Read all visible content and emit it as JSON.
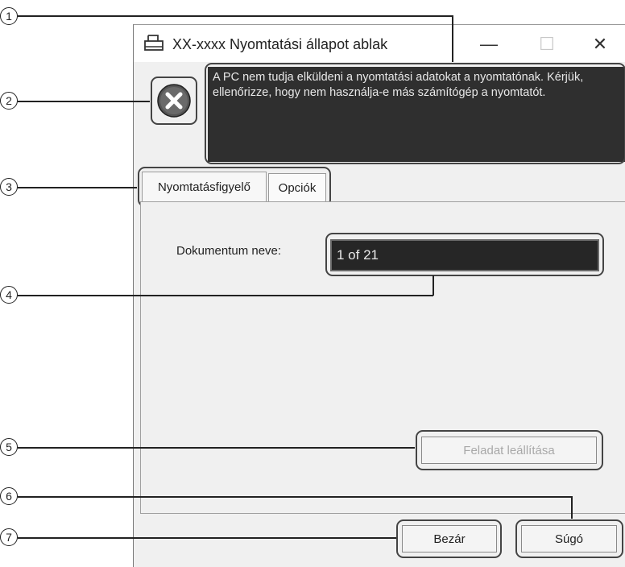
{
  "window": {
    "title": "XX-xxxx  Nyomtatási állapot ablak",
    "minimize_glyph": "—",
    "maximize_glyph": "☐",
    "close_glyph": "✕"
  },
  "status": {
    "icon": "error-x-icon",
    "message": "A PC nem tudja elküldeni a nyomtatási adatokat a nyomtatónak. Kérjük, ellenőrizze, hogy nem használja-e más számítógép a nyomtatót."
  },
  "tabs": [
    {
      "label": "Nyomtatásfigyelő",
      "active": true
    },
    {
      "label": "Opciók",
      "active": false
    }
  ],
  "document": {
    "label": "Dokumentum neve:",
    "value": "1 of 21"
  },
  "buttons": {
    "stop_job": "Feladat leállítása",
    "close": "Bezár",
    "help": "Súgó"
  },
  "callouts": [
    "1",
    "2",
    "3",
    "4",
    "5",
    "6",
    "7"
  ],
  "colors": {
    "message_bg": "#2f2f2f",
    "window_bg": "#f0f0f0",
    "error_icon": "#555555"
  }
}
